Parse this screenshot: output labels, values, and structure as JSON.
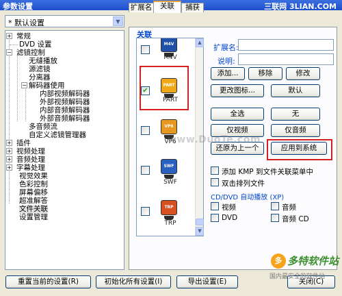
{
  "window": {
    "title": "参数设置",
    "brand": "三联网 3LIAN.COM"
  },
  "preset": {
    "value": "* 默认设置"
  },
  "tree": {
    "items": [
      {
        "label": "常规"
      },
      {
        "label": "DVD 设置"
      },
      {
        "label": "滤镜控制"
      },
      {
        "label": "无缝播放"
      },
      {
        "label": "源滤镜"
      },
      {
        "label": "分离器"
      },
      {
        "label": "解码器使用"
      },
      {
        "label": "内部视频解码器"
      },
      {
        "label": "外部视频解码器"
      },
      {
        "label": "内部音频解码器"
      },
      {
        "label": "外部音频解码器"
      },
      {
        "label": "多音频流"
      },
      {
        "label": "自定义滤镜管理器"
      },
      {
        "label": "插件"
      },
      {
        "label": "视频处理"
      },
      {
        "label": "音频处理"
      },
      {
        "label": "字幕处理"
      },
      {
        "label": "视觉效果"
      },
      {
        "label": "色彩控制"
      },
      {
        "label": "屏幕偏移"
      },
      {
        "label": "超准解答"
      },
      {
        "label": "文件关联"
      },
      {
        "label": "设置管理"
      }
    ]
  },
  "tabs": [
    {
      "label": "扩展名"
    },
    {
      "label": "关联"
    },
    {
      "label": "捕获"
    }
  ],
  "assoc": {
    "group_title": "关联",
    "items": [
      {
        "label": "M4V",
        "color": "#2050a8",
        "checked": false
      },
      {
        "label": "PART",
        "color": "#f0a818",
        "checked": true
      },
      {
        "label": "VP6",
        "color": "#e89820",
        "checked": false
      },
      {
        "label": "SWF",
        "color": "#2a60c0",
        "checked": false
      },
      {
        "label": "TRP",
        "color": "#d85020",
        "checked": false
      }
    ]
  },
  "fields": {
    "ext_label": "扩展名:",
    "desc_label": "说明:",
    "ext_value": "",
    "desc_value": ""
  },
  "buttons": {
    "add": "添加...",
    "remove": "移除",
    "modify": "修改",
    "change_icon": "更改图标...",
    "default": "默认",
    "select_all": "全选",
    "none": "无",
    "video_only": "仅视频",
    "audio_only": "仅音频",
    "restore_prev": "还原为上一个",
    "apply_system": "应用到系统"
  },
  "options": {
    "add_menu": "添加 KMP 到文件关联菜单中",
    "dblclick_queue": "双击排列文件",
    "autoplay_title": "CD/DVD 自动播放 (XP)",
    "video": "视频",
    "audio": "音频",
    "dvd": "DVD",
    "audio_cd": "音频 CD"
  },
  "bottom": {
    "reset_current": "重置当前的设置(R)",
    "init_all": "初始化所有设置(I)",
    "export": "导出设置(E)",
    "close": "关闭(C)"
  },
  "watermark": "www.DuoTe.com",
  "logo": {
    "badge": "多",
    "big": "多特软件站",
    "small": "国内最安全的软件站"
  }
}
